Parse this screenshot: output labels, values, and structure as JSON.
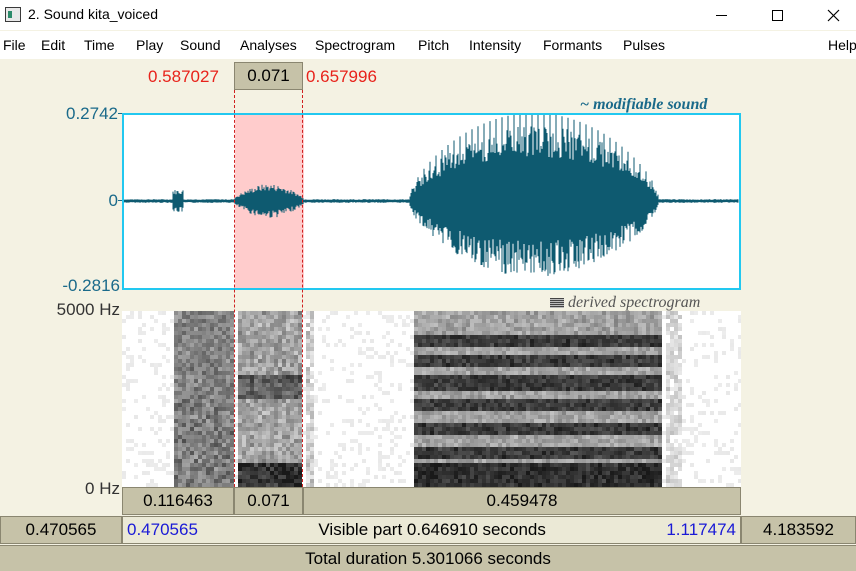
{
  "window": {
    "title": "2. Sound kita_voiced",
    "icon": "praat-sound-window-icon",
    "controls": {
      "minimize": "minimize-icon",
      "maximize": "maximize-icon",
      "close": "close-icon"
    }
  },
  "menu": {
    "items": [
      "File",
      "Edit",
      "Time",
      "Play",
      "Sound",
      "Analyses",
      "Spectrogram",
      "Pitch",
      "Intensity",
      "Formants",
      "Pulses",
      "Help"
    ]
  },
  "selection": {
    "start": "0.587027",
    "duration": "0.071",
    "end": "0.657996"
  },
  "waveform": {
    "caption": "~ modifiable sound",
    "y_max": "0.2742",
    "y_zero": "0",
    "y_min": "-0.2816",
    "color": "#0e5a70",
    "border_color": "#22c8f0",
    "selection_fill": "#ffcccc"
  },
  "spectrogram": {
    "caption": "derived spectrogram",
    "y_max": "5000 Hz",
    "y_min": "0 Hz"
  },
  "duration_bar": {
    "before": "0.116463",
    "selected": "0.071",
    "after": "0.459478"
  },
  "visible_bar": {
    "left_outside": "0.470565",
    "window_start": "0.470565",
    "label": "Visible part 0.646910 seconds",
    "window_end": "1.117474",
    "right_outside": "4.183592"
  },
  "total": {
    "label": "Total duration 5.301066 seconds"
  },
  "colors": {
    "background": "#f4f2e3",
    "bar": "#c6c2a8",
    "selection_numbers": "#e8231b",
    "window_numbers": "#1a1ad6"
  }
}
